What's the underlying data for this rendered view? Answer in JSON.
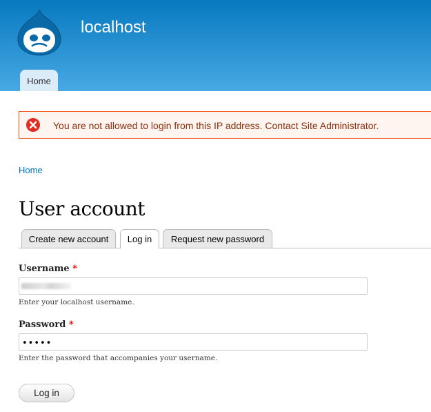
{
  "header": {
    "site_name": "localhost",
    "logo_icon": "drupal-drop-icon",
    "nav": [
      {
        "label": "Home"
      }
    ]
  },
  "message": {
    "icon": "error-x-icon",
    "text": "You are not allowed to login from this IP address. Contact Site Administrator."
  },
  "breadcrumb": {
    "home": "Home"
  },
  "page": {
    "title": "User account"
  },
  "tabs": [
    {
      "label": "Create new account",
      "active": false
    },
    {
      "label": "Log in",
      "active": true
    },
    {
      "label": "Request new password",
      "active": false
    }
  ],
  "form": {
    "username": {
      "label": "Username",
      "required_marker": "*",
      "description": "Enter your localhost username."
    },
    "password": {
      "label": "Password",
      "required_marker": "*",
      "value_masked": "•••••",
      "description": "Enter the password that accompanies your username."
    },
    "submit_label": "Log in"
  },
  "colors": {
    "header_top": "#0779bf",
    "header_bottom": "#48a9e4",
    "error_border": "#ed541d",
    "error_text": "#8c2e0b",
    "link": "#0071b3"
  }
}
